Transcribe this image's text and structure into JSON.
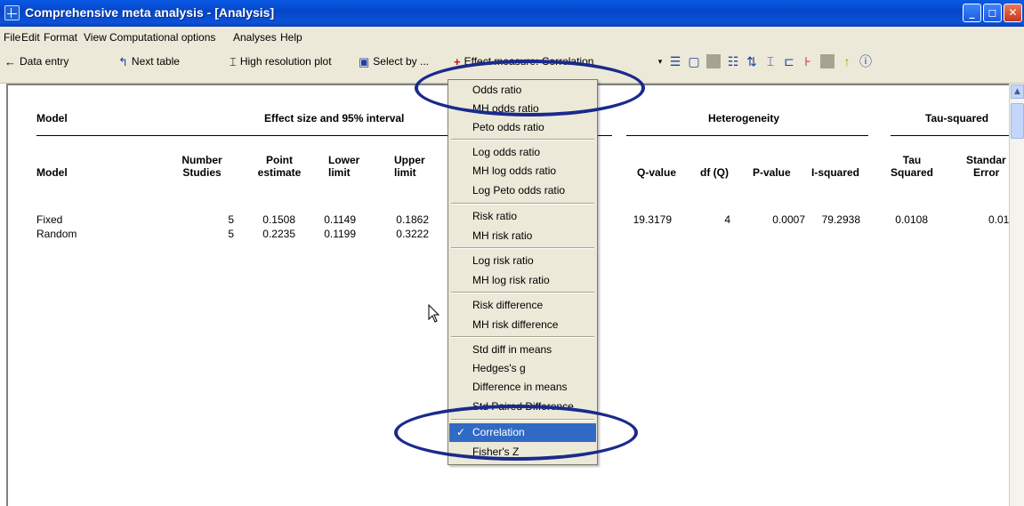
{
  "window": {
    "title": "Comprehensive meta analysis - [Analysis]",
    "buttons": [
      "_",
      "◻",
      "✕"
    ]
  },
  "menu": [
    "File",
    "Edit",
    "Format",
    "View",
    "Computational options",
    "Analyses",
    "Help"
  ],
  "toolbar": {
    "data_entry": "Data entry",
    "next_table": "Next table",
    "high_resolution_plot": "High resolution plot",
    "select_by": "Select by ...",
    "effect_measure": "Effect measure: Correlation"
  },
  "table": {
    "group_headers": {
      "model": "Model",
      "effect_size": "Effect size and 95% interval",
      "heterogeneity": "Heterogeneity",
      "tau_squared": "Tau-squared"
    },
    "columns": {
      "model": "Model",
      "number_studies_1": "Number",
      "number_studies_2": "Studies",
      "point_1": "Point",
      "point_2": "estimate",
      "lower_1": "Lower",
      "lower_2": "limit",
      "upper_1": "Upper",
      "upper_2": "limit",
      "q_value": "Q-value",
      "df_q": "df (Q)",
      "p_value": "P-value",
      "i_squared": "I-squared",
      "tau_1": "Tau",
      "tau_2": "Squared",
      "se_1": "Standar",
      "se_2": "Error"
    },
    "rows": [
      {
        "model": "Fixed",
        "studies": "5",
        "point": "0.1508",
        "lower": "0.1149",
        "upper": "0.1862",
        "q": "19.3179",
        "df": "4",
        "p": "0.0007",
        "i2": "79.2938",
        "tau2": "0.0108",
        "se": "0.01"
      },
      {
        "model": "Random",
        "studies": "5",
        "point": "0.2235",
        "lower": "0.1199",
        "upper": "0.3222"
      }
    ]
  },
  "dropdown": {
    "items": [
      "Odds ratio",
      "MH odds ratio",
      "Peto odds ratio",
      "Log odds ratio",
      "MH log odds ratio",
      "Log Peto odds ratio",
      "Risk ratio",
      "MH risk ratio",
      "Log risk ratio",
      "MH log risk ratio",
      "Risk difference",
      "MH risk difference",
      "Std diff in means",
      "Hedges's g",
      "Difference in means",
      "Std Paired Difference",
      "Correlation",
      "Fisher's Z"
    ],
    "selected": "Correlation",
    "check_mark": "✓"
  },
  "colors": {
    "titlebar": "#0a52d8",
    "chrome": "#ece9d8",
    "selection": "#316ac5",
    "annotation": "#1a2a8c",
    "effect_icon": "#c81010"
  }
}
